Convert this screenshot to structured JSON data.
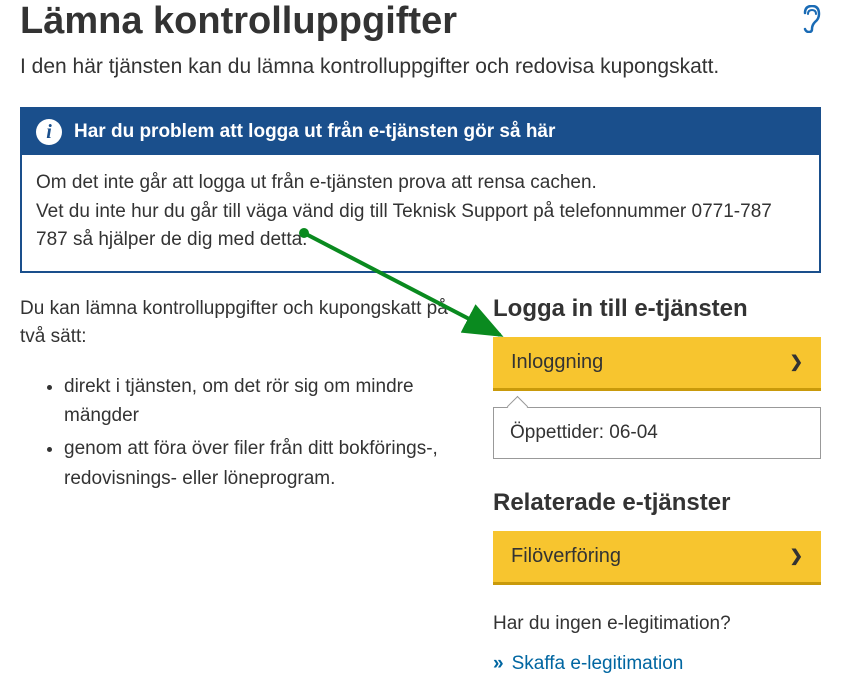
{
  "header": {
    "title": "Lämna kontrolluppgifter"
  },
  "intro": "I den här tjänsten kan du lämna kontrolluppgifter och redovisa kupongskatt.",
  "info_box": {
    "title": "Har du problem att logga ut från e-tjänsten gör så här",
    "line1": "Om det inte går att logga ut från e-tjänsten prova att rensa cachen.",
    "line2": "Vet du inte hur du går till väga vänd dig till Teknisk Support på telefonnummer 0771-787 787 så hjälper de dig med detta."
  },
  "left": {
    "lead": "Du kan lämna kontrolluppgifter och kupongskatt på två sätt:",
    "bullet1": "direkt i tjänsten, om det rör sig om mindre mängder",
    "bullet2": "genom att föra över filer från ditt bokförings-, redovisnings- eller löneprogram."
  },
  "right": {
    "login_heading": "Logga in till e-tjänsten",
    "login_button": "Inloggning",
    "hours": "Öppettider: 06-04",
    "related_heading": "Relaterade e-tjänster",
    "file_transfer_button": "Filöverföring",
    "question": "Har du ingen e-legitimation?",
    "get_eid_link": "Skaffa e-legitimation"
  }
}
